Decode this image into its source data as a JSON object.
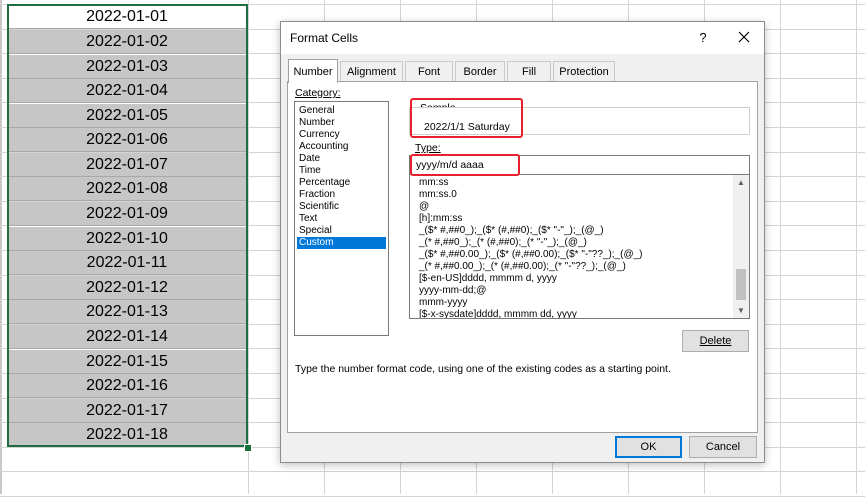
{
  "sheet": {
    "cells": [
      "2022-01-01",
      "2022-01-02",
      "2022-01-03",
      "2022-01-04",
      "2022-01-05",
      "2022-01-06",
      "2022-01-07",
      "2022-01-08",
      "2022-01-09",
      "2022-01-10",
      "2022-01-11",
      "2022-01-12",
      "2022-01-13",
      "2022-01-14",
      "2022-01-15",
      "2022-01-16",
      "2022-01-17",
      "2022-01-18"
    ]
  },
  "dialog": {
    "title": "Format Cells",
    "help": "?",
    "tabs": [
      "Number",
      "Alignment",
      "Font",
      "Border",
      "Fill",
      "Protection"
    ],
    "category_label": "Category:",
    "categories": [
      "General",
      "Number",
      "Currency",
      "Accounting",
      "Date",
      "Time",
      "Percentage",
      "Fraction",
      "Scientific",
      "Text",
      "Special",
      "Custom"
    ],
    "selected_category": "Custom",
    "sample_label": "Sample",
    "sample_value": "2022/1/1 Saturday",
    "type_label": "Type:",
    "type_value": "yyyy/m/d aaaa",
    "format_codes": [
      "mm:ss",
      "mm:ss.0",
      "@",
      "[h]:mm:ss",
      "_($* #,##0_);_($* (#,##0);_($* \"-\"_);_(@_)",
      "_(* #,##0_);_(* (#,##0);_(* \"-\"_);_(@_)",
      "_($* #,##0.00_);_($* (#,##0.00);_($* \"-\"??_);_(@_)",
      "_(* #,##0.00_);_(* (#,##0.00);_(* \"-\"??_);_(@_)",
      "[$-en-US]dddd, mmmm d, yyyy",
      "yyyy-mm-dd;@",
      "mmm-yyyy",
      "[$-x-sysdate]dddd, mmmm dd, yyyy"
    ],
    "delete_label": "Delete",
    "description": "Type the number format code, using one of the existing codes as a starting point.",
    "ok_label": "OK",
    "cancel_label": "Cancel"
  },
  "colors": {
    "selection_green": "#1e6e42",
    "annotation_red": "#e8202c",
    "selected_blue": "#0078d7"
  }
}
